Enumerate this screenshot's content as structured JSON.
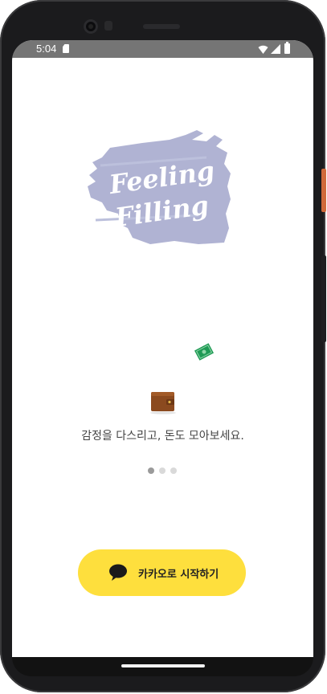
{
  "status_bar": {
    "time": "5:04"
  },
  "logo": {
    "line1": "Feeling",
    "line2": "Filling",
    "brush_color": "#a9adcf"
  },
  "onboarding": {
    "tagline": "감정을 다스리고, 돈도 모아보세요.",
    "page_count": 3,
    "current_page": 1
  },
  "login": {
    "button_label": "카카오로 시작하기",
    "button_color": "#fedf3d"
  },
  "colors": {
    "status_bar": "#757575",
    "dot_active": "#9a9a9a",
    "dot_inactive": "#d9d9d9"
  }
}
